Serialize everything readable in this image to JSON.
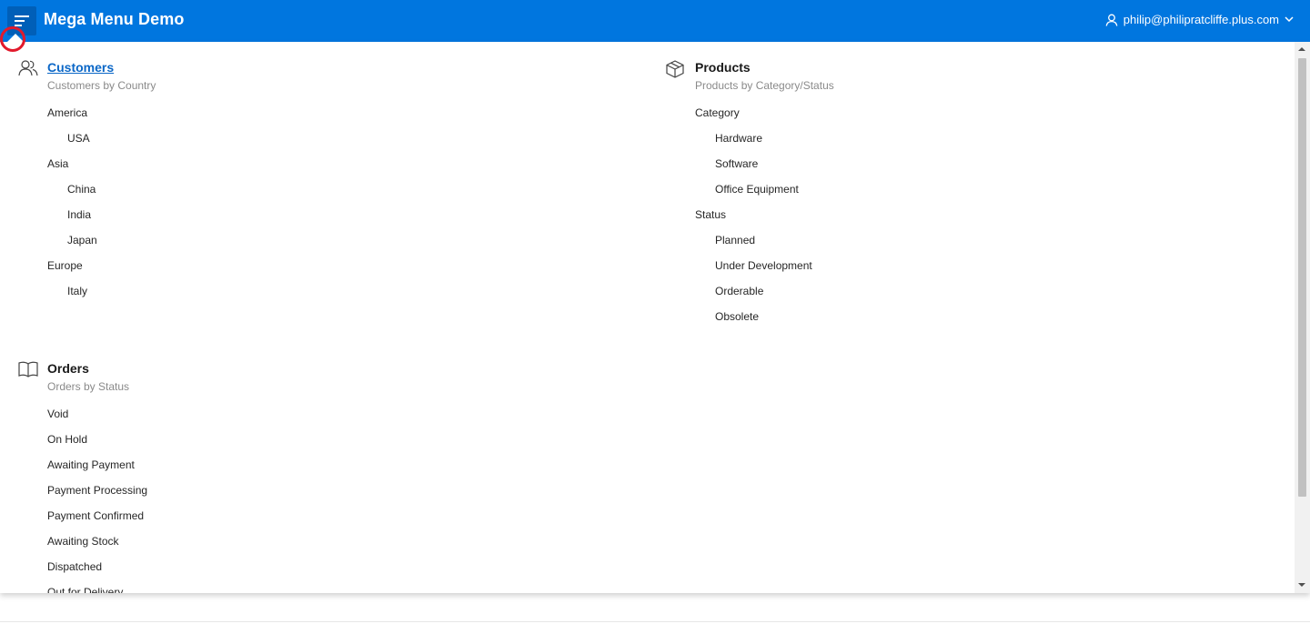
{
  "header": {
    "title": "Mega Menu Demo",
    "menu_icon": "hamburger-icon",
    "user": "philip@philipratcliffe.plus.com",
    "user_icon": "user-icon",
    "dropdown_icon": "chevron-down-icon",
    "bar_color": "#0076df"
  },
  "menu": {
    "customers": {
      "icon": "users-icon",
      "title": "Customers",
      "subtitle": "Customers by Country",
      "items": [
        "America",
        "USA",
        "Asia",
        "China",
        "India",
        "Japan",
        "Europe",
        "Italy"
      ]
    },
    "products": {
      "icon": "box-icon",
      "title": "Products",
      "subtitle": "Products by Category/Status",
      "items": [
        "Category",
        "Hardware",
        "Software",
        "Office Equipment",
        "Status",
        "Planned",
        "Under Development",
        "Orderable",
        "Obsolete"
      ]
    },
    "orders": {
      "icon": "book-icon",
      "title": "Orders",
      "subtitle": "Orders by Status",
      "items": [
        "Void",
        "On Hold",
        "Awaiting Payment",
        "Payment Processing",
        "Payment Confirmed",
        "Awaiting Stock",
        "Dispatched",
        "Out for Delivery"
      ]
    }
  }
}
